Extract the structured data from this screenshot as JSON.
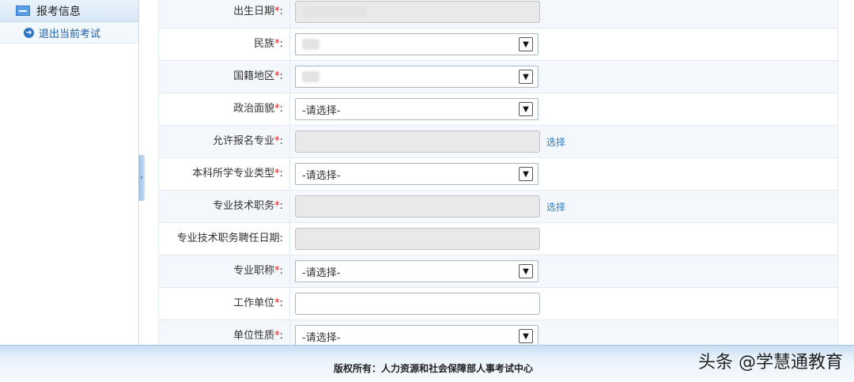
{
  "sidebar": {
    "header": "报考信息",
    "items": [
      {
        "label": "退出当前考试"
      }
    ]
  },
  "form": {
    "rows": [
      {
        "label": "出生日期",
        "required": "*",
        "colon": ":"
      },
      {
        "label": "民族",
        "required": "*",
        "colon": ":"
      },
      {
        "label": "国籍地区",
        "required": "*",
        "colon": ":"
      },
      {
        "label": "政治面貌",
        "required": "*",
        "colon": ":",
        "value": "-请选择-"
      },
      {
        "label": "允许报名专业",
        "required": "*",
        "colon": ":",
        "link": "选择"
      },
      {
        "label": "本科所学专业类型",
        "required": "*",
        "colon": ":",
        "value": "-请选择-"
      },
      {
        "label": "专业技术职务",
        "required": "*",
        "colon": ":",
        "link": "选择"
      },
      {
        "label": "专业技术职务聘任日期",
        "colon": ":"
      },
      {
        "label": "专业职称",
        "required": "*",
        "colon": ":",
        "value": "-请选择-"
      },
      {
        "label": "工作单位",
        "required": "*",
        "colon": ":"
      },
      {
        "label": "单位性质",
        "required": "*",
        "colon": ":",
        "value": "-请选择-"
      }
    ]
  },
  "footer": {
    "copyright": "版权所有：人力资源和社会保障部人事考试中心"
  },
  "watermark": "头条 @学慧通教育",
  "icons": {
    "dropdown": "chevron-down-icon",
    "sidebar_header": "window-icon",
    "sidebar_item": "arrow-circle-icon",
    "splitter": "collapse-handle-icon"
  }
}
